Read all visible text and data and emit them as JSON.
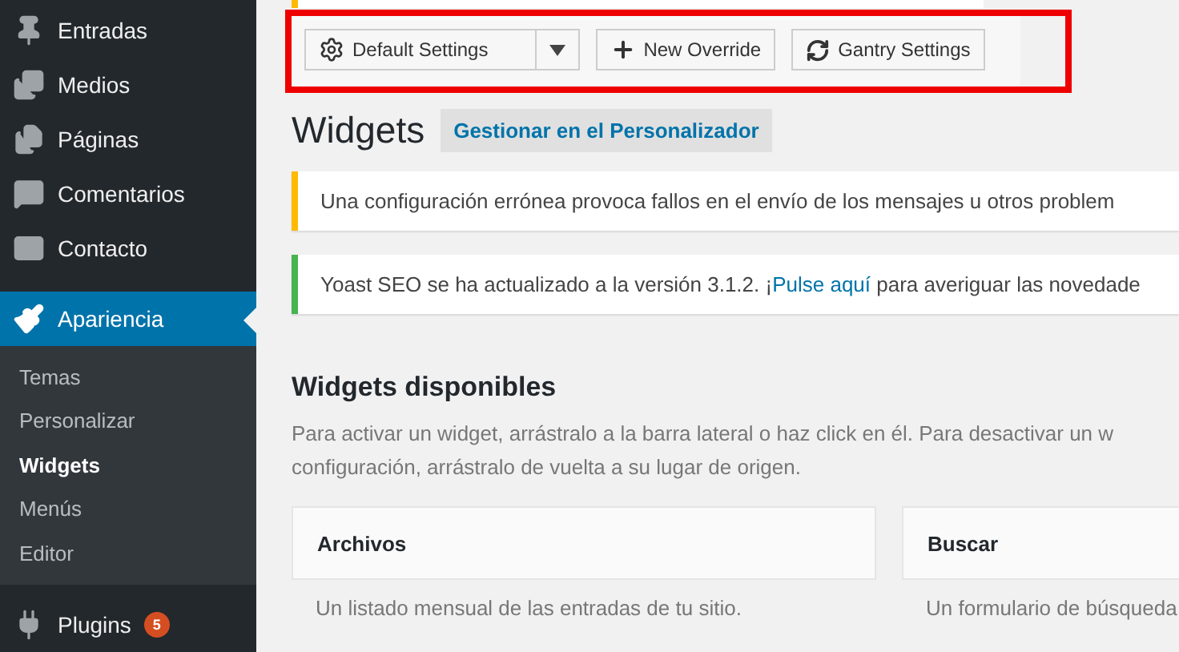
{
  "sidebar": {
    "items": [
      {
        "label": "Entradas",
        "selected": false
      },
      {
        "label": "Medios",
        "selected": false
      },
      {
        "label": "Páginas",
        "selected": false
      },
      {
        "label": "Comentarios",
        "selected": false
      },
      {
        "label": "Contacto",
        "selected": false
      },
      {
        "label": "Apariencia",
        "selected": true,
        "children": [
          {
            "label": "Temas",
            "selected": false
          },
          {
            "label": "Personalizar",
            "selected": false
          },
          {
            "label": "Widgets",
            "selected": true
          },
          {
            "label": "Menús",
            "selected": false
          },
          {
            "label": "Editor",
            "selected": false
          }
        ]
      },
      {
        "label": "Plugins",
        "selected": false,
        "badge": "5"
      }
    ]
  },
  "gantry_toolbar": {
    "highlighted": true,
    "dropdown": "Default Settings",
    "buttons": [
      "New Override",
      "Gantry Settings"
    ]
  },
  "heading": {
    "title": "Widgets",
    "action": "Gestionar en el Personalizador"
  },
  "notices": [
    {
      "kind": "warning",
      "text": "Una configuración errónea provoca fallos en el envío de los mensajes u otros problem"
    },
    {
      "kind": "success",
      "text": "Yoast SEO se ha actualizado a la versión 3.1.2. ¡",
      "link": "Pulse aquí",
      "after": " para averiguar las novedade"
    }
  ],
  "available": {
    "title": "Widgets disponibles",
    "description": [
      "Para activar un widget, arrástralo a la barra lateral o haz click en él. Para desactivar un w",
      "configuración, arrástralo de vuelta a su lugar de origen."
    ],
    "widgets": [
      {
        "title": "Archivos",
        "description": "Un listado mensual de las entradas de tu sitio."
      },
      {
        "title": "Buscar",
        "description": "Un formulario de búsqueda"
      }
    ]
  }
}
